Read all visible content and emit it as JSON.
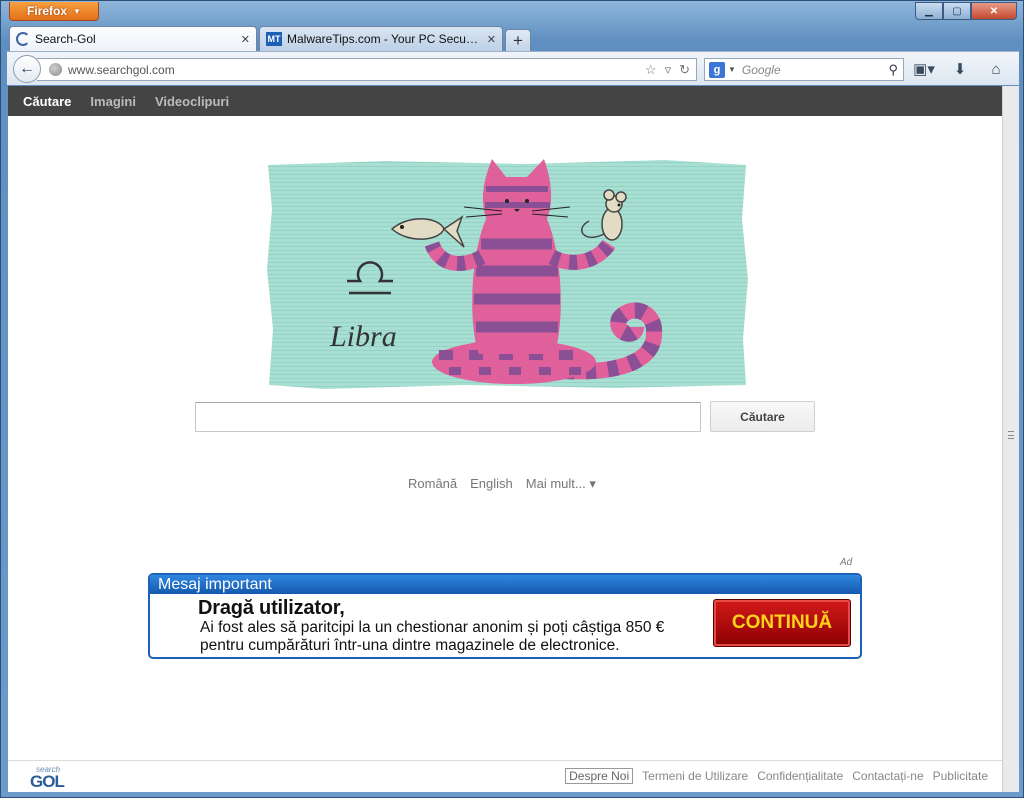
{
  "browser": {
    "menu_button": "Firefox",
    "tabs": [
      {
        "title": "Search-Gol",
        "active": true
      },
      {
        "title": "MalwareTips.com - Your PC Security ...",
        "active": false
      }
    ],
    "favicon_mt": "MT",
    "url": "www.searchgol.com",
    "search_placeholder": "Google",
    "search_engine_letter": "g"
  },
  "site_nav": {
    "items": [
      "Căutare",
      "Imagini",
      "Videoclipuri"
    ]
  },
  "doodle": {
    "caption": "Libra"
  },
  "search": {
    "button_label": "Căutare",
    "placeholder": ""
  },
  "languages": {
    "items": [
      "Română",
      "English",
      "Mai mult... ▾"
    ]
  },
  "ad": {
    "label": "Ad",
    "header": "Mesaj important",
    "title": "Dragă utilizator,",
    "line1": "Ai fost ales să paritcipi la un chestionar anonim și poți câștiga 850 €",
    "line2": "pentru cumpărături într-una dintre magazinele de electronice.",
    "button": "CONTINUĂ"
  },
  "footer": {
    "logo_small": "search",
    "logo_big": "GOL",
    "links": [
      "Despre Noi",
      "Termeni de Utilizare",
      "Confidențialitate",
      "Contactați-ne",
      "Publicitate"
    ]
  },
  "colors": {
    "site_nav_bg": "#444444",
    "banner_blue": "#1b62b6",
    "continue_red": "#b00000",
    "continue_text": "#ffd21c",
    "doodle_bg": "#a8dfd3",
    "cat_pink": "#e0609c",
    "cat_purple": "#8a4f95"
  }
}
